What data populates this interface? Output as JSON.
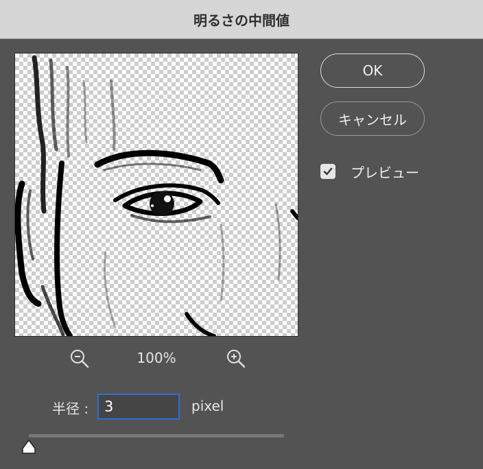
{
  "window": {
    "title": "明るさの中間値"
  },
  "buttons": {
    "ok_label": "OK",
    "cancel_label": "キャンセル"
  },
  "preview_toggle": {
    "label": "プレビュー",
    "checked": true
  },
  "zoom": {
    "level": "100%"
  },
  "radius": {
    "label": "半径 :",
    "value": "3",
    "unit": "pixel",
    "slider_fraction": 0.0
  },
  "colors": {
    "accent": "#2f6fd6",
    "background": "#535353",
    "titlebar": "#d6d6d6"
  }
}
